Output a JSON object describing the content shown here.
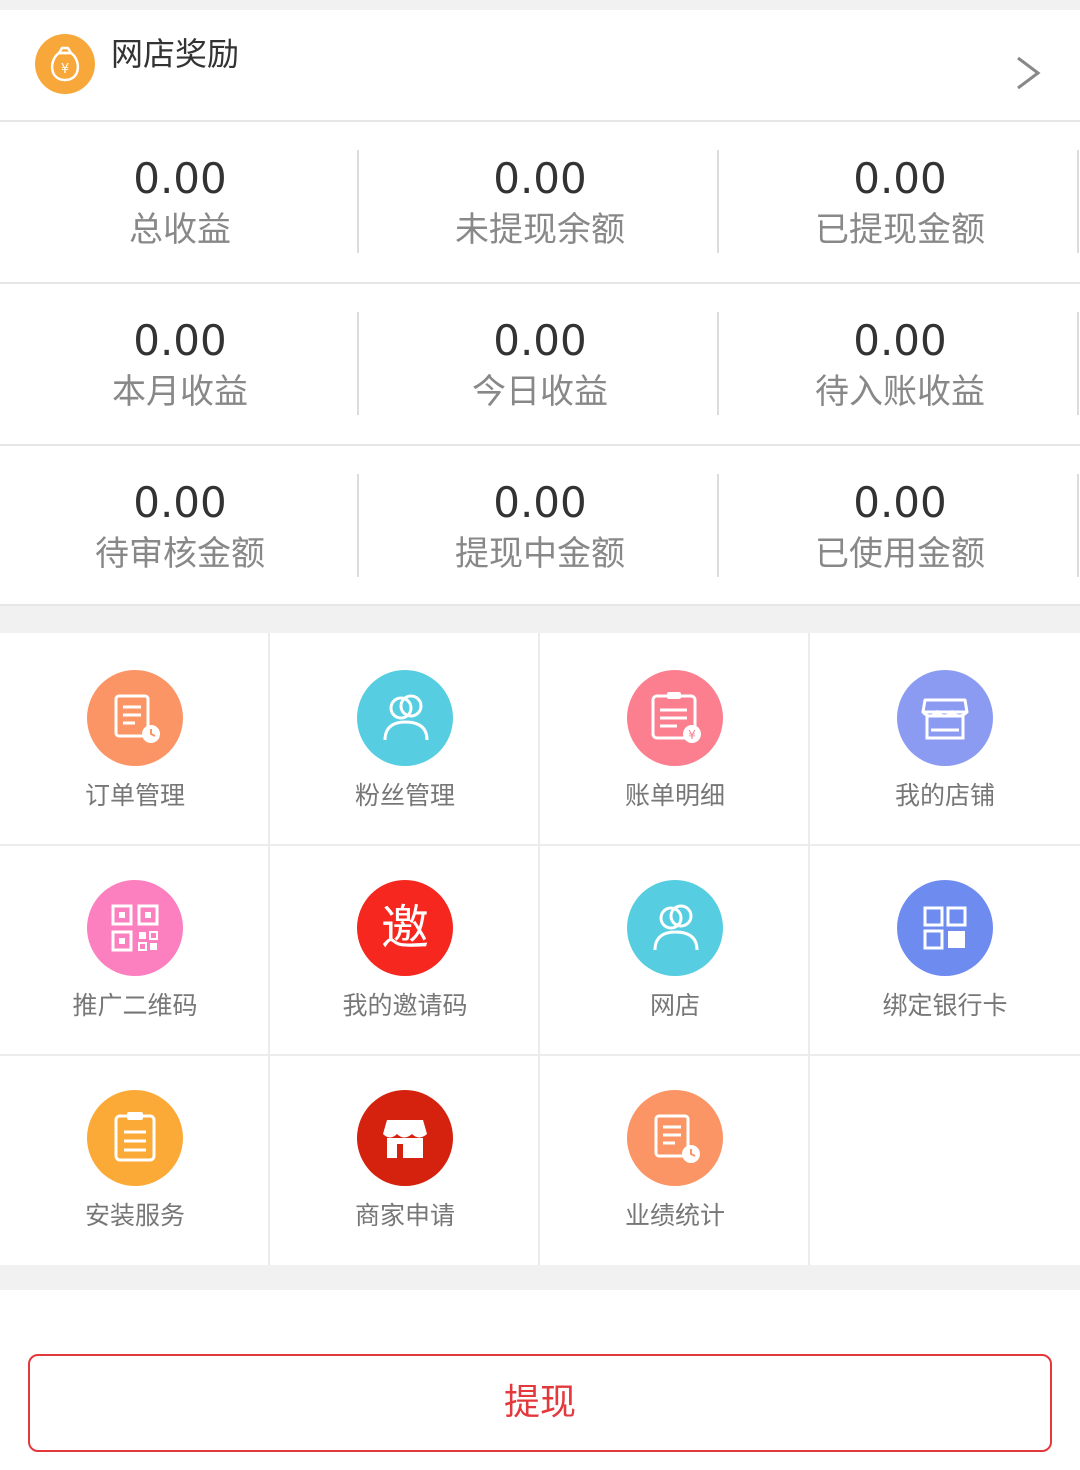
{
  "header": {
    "title": "网店奖励"
  },
  "stats": [
    [
      {
        "value": "0.00",
        "label": "总收益"
      },
      {
        "value": "0.00",
        "label": "未提现余额"
      },
      {
        "value": "0.00",
        "label": "已提现金额"
      }
    ],
    [
      {
        "value": "0.00",
        "label": "本月收益"
      },
      {
        "value": "0.00",
        "label": "今日收益"
      },
      {
        "value": "0.00",
        "label": "待入账收益"
      }
    ],
    [
      {
        "value": "0.00",
        "label": "待审核金额"
      },
      {
        "value": "0.00",
        "label": "提现中金额"
      },
      {
        "value": "0.00",
        "label": "已使用金额"
      }
    ]
  ],
  "grid": [
    {
      "label": "订单管理",
      "icon": "order-list-icon",
      "color": "#fb9566"
    },
    {
      "label": "粉丝管理",
      "icon": "fans-icon",
      "color": "#56cde0"
    },
    {
      "label": "账单明细",
      "icon": "bill-icon",
      "color": "#fb7f8f"
    },
    {
      "label": "我的店铺",
      "icon": "store-icon",
      "color": "#8c9bf2"
    },
    {
      "label": "推广二维码",
      "icon": "qr-code-icon",
      "color": "#fc7fbf"
    },
    {
      "label": "我的邀请码",
      "icon": "invite-icon",
      "color": "#f5271e",
      "glyph": "邀"
    },
    {
      "label": "网店",
      "icon": "user-icon",
      "color": "#56cde0"
    },
    {
      "label": "绑定银行卡",
      "icon": "grid-icon",
      "color": "#6e8bf0"
    },
    {
      "label": "安装服务",
      "icon": "clipboard-icon",
      "color": "#fcaa37"
    },
    {
      "label": "商家申请",
      "icon": "shop-icon",
      "color": "#d4220f"
    },
    {
      "label": "业绩统计",
      "icon": "report-icon",
      "color": "#fb9566"
    }
  ],
  "withdraw": {
    "label": "提现"
  },
  "colors": {
    "accent": "#e4393c",
    "header_coin": "#f8a83a"
  }
}
